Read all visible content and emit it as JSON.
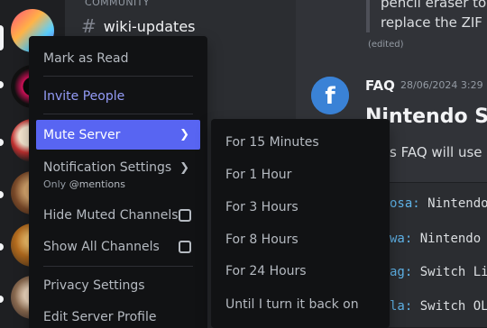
{
  "channels": {
    "category": "COMMUNITY",
    "active_channel": "wiki-updates"
  },
  "chat": {
    "quote_lines": [
      "pencil eraser to u",
      "replace the ZIF c"
    ],
    "edited": "(edited)",
    "author": "FAQ",
    "avatar_letter": "f",
    "timestamp": "28/06/2024 3:29 |",
    "title": "Nintendo Sw",
    "body": "s FAQ will use co",
    "code_lines": [
      {
        "k": "osa:",
        "v": " Nintendo"
      },
      {
        "k": "wa:",
        "v": " Nintendo"
      },
      {
        "k": "ag:",
        "v": " Switch Li"
      },
      {
        "k": "la:",
        "v": " Switch OL"
      }
    ]
  },
  "menu": {
    "mark_as_read": "Mark as Read",
    "invite_people": "Invite People",
    "mute_server": "Mute Server",
    "notification_settings": "Notification Settings",
    "notification_sub_prefix": "Only ",
    "notification_sub_value": "@mentions",
    "hide_muted": "Hide Muted Channels",
    "show_all": "Show All Channels",
    "privacy": "Privacy Settings",
    "edit_profile": "Edit Server Profile"
  },
  "submenu": {
    "items": [
      "For 15 Minutes",
      "For 1 Hour",
      "For 3 Hours",
      "For 8 Hours",
      "For 24 Hours",
      "Until I turn it back on"
    ]
  },
  "colors": {
    "accent": "#5865f2",
    "invite": "#949cf7",
    "menu_bg": "#111214"
  }
}
